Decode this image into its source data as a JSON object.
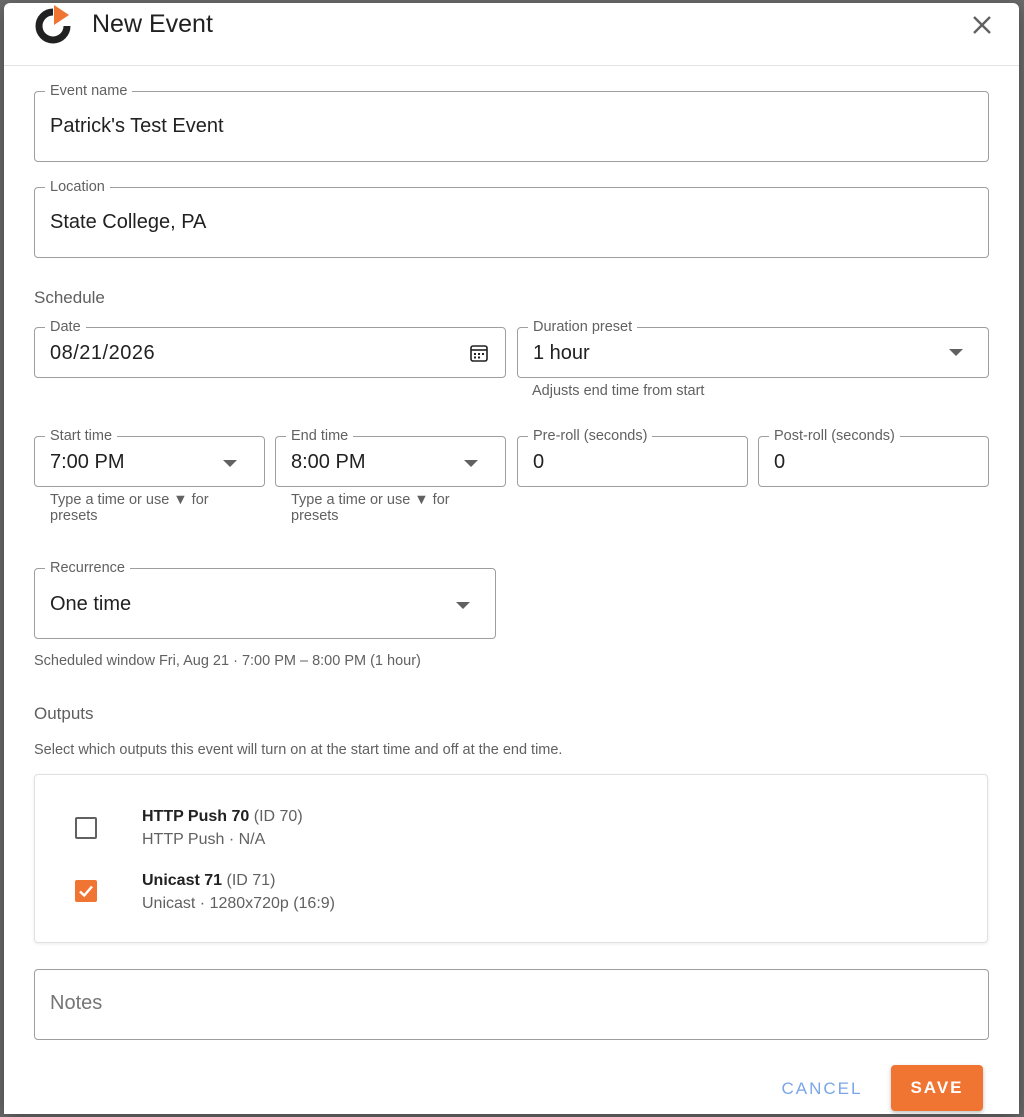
{
  "dialog": {
    "title": "New Event",
    "logo_icon": "power-play-logo-icon",
    "close_icon": "close-icon"
  },
  "event_name": {
    "label": "Event name",
    "value": "Patrick's Test Event"
  },
  "location": {
    "label": "Location",
    "value": "State College, PA"
  },
  "schedule": {
    "heading": "Schedule",
    "date": {
      "label": "Date",
      "value": "08/21/2026",
      "icon": "calendar-icon"
    },
    "duration_preset": {
      "label": "Duration preset",
      "value": "1 hour",
      "helper": "Adjusts end time from start"
    },
    "start_time": {
      "label": "Start time",
      "value": "7:00 PM",
      "helper_line1": "Type a time or use ▼ for",
      "helper_line2": "presets"
    },
    "end_time": {
      "label": "End time",
      "value": "8:00 PM",
      "helper_line1": "Type a time or use ▼ for",
      "helper_line2": "presets"
    },
    "pre_roll": {
      "label": "Pre-roll (seconds)",
      "value": "0"
    },
    "post_roll": {
      "label": "Post-roll (seconds)",
      "value": "0"
    },
    "recurrence": {
      "label": "Recurrence",
      "value": "One time"
    },
    "window_summary": "Scheduled window Fri, Aug 21 · 7:00 PM – 8:00 PM (1 hour)"
  },
  "outputs": {
    "heading": "Outputs",
    "description": "Select which outputs this event will turn on at the start time and off at the end time.",
    "items": [
      {
        "name": "HTTP Push 70",
        "id_text": "(ID 70)",
        "subtitle": "HTTP Push · N/A",
        "checked": false
      },
      {
        "name": "Unicast 71",
        "id_text": "(ID 71)",
        "subtitle": "Unicast · 1280x720p (16:9)",
        "checked": true
      }
    ]
  },
  "notes": {
    "placeholder": "Notes"
  },
  "actions": {
    "cancel_label": "CANCEL",
    "save_label": "SAVE"
  },
  "colors": {
    "accent": "#f07432",
    "link": "#7aa6e8"
  }
}
